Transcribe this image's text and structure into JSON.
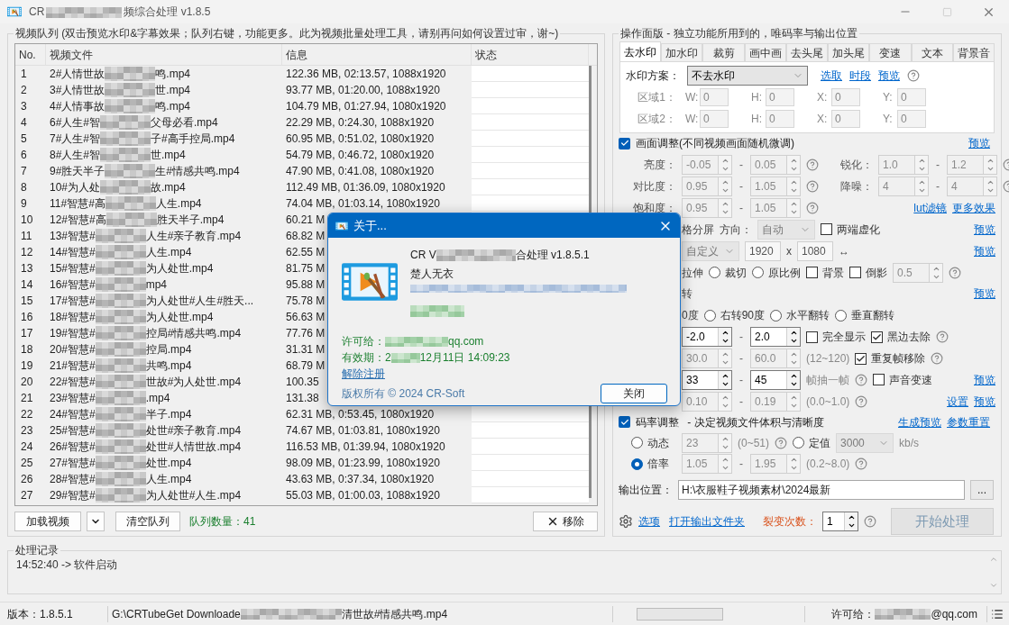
{
  "window": {
    "title_start": "CR",
    "title_end": "频综合处理 v1.8.5"
  },
  "queue": {
    "title": "视频队列 (双击预览水印&字幕效果；队列右键，功能更多。此为视频批量处理工具，请别再问如何设置过审，谢~)",
    "columns": [
      "No.",
      "视频文件",
      "信息",
      "状态"
    ],
    "rows": [
      {
        "no": "1",
        "file_start": "2#人情世故",
        "file_end": "鸣.mp4",
        "info": "122.36 MB, 02:13.57, 1088x1920"
      },
      {
        "no": "2",
        "file_start": "3#人情世故",
        "file_end": "世.mp4",
        "info": "93.77 MB, 01:20.00, 1088x1920"
      },
      {
        "no": "3",
        "file_start": "4#人情事故",
        "file_end": "鸣.mp4",
        "info": "104.79 MB, 01:27.94, 1080x1920"
      },
      {
        "no": "4",
        "file_start": "6#人生#智",
        "file_end": "父母必看.mp4",
        "info": "22.29 MB, 0:24.30, 1088x1920"
      },
      {
        "no": "5",
        "file_start": "7#人生#智",
        "file_end": "子#高手控局.mp4",
        "info": "60.95 MB, 0:51.02, 1080x1920"
      },
      {
        "no": "6",
        "file_start": "8#人生#智",
        "file_end": "世.mp4",
        "info": "54.79 MB, 0:46.72, 1080x1920"
      },
      {
        "no": "7",
        "file_start": "9#胜天半子",
        "file_end": "生#情感共鸣.mp4",
        "info": "47.90 MB, 0:41.08, 1080x1920"
      },
      {
        "no": "8",
        "file_start": "10#为人处",
        "file_end": "故.mp4",
        "info": "112.49 MB, 01:36.09, 1080x1920"
      },
      {
        "no": "9",
        "file_start": "11#智慧#高",
        "file_end": "人生.mp4",
        "info": "74.04 MB, 01:03.14, 1080x1920"
      },
      {
        "no": "10",
        "file_start": "12#智慧#高",
        "file_end": "胜天半子.mp4",
        "info": "60.21 M"
      },
      {
        "no": "11",
        "file_start": "13#智慧#",
        "file_end": "人生#亲子教育.mp4",
        "info": "68.82 M"
      },
      {
        "no": "12",
        "file_start": "14#智慧#",
        "file_end": "人生.mp4",
        "info": "62.55 M"
      },
      {
        "no": "13",
        "file_start": "15#智慧#",
        "file_end": "为人处世.mp4",
        "info": "81.75 M"
      },
      {
        "no": "14",
        "file_start": "16#智慧#",
        "file_end": "mp4",
        "info": "95.88 M"
      },
      {
        "no": "15",
        "file_start": "17#智慧#",
        "file_end": "为人处世#人生#胜天...",
        "info": "75.78 M"
      },
      {
        "no": "16",
        "file_start": "18#智慧#",
        "file_end": "为人处世.mp4",
        "info": "56.63 M"
      },
      {
        "no": "17",
        "file_start": "19#智慧#",
        "file_end": "控局#情感共鸣.mp4",
        "info": "77.76 M"
      },
      {
        "no": "18",
        "file_start": "20#智慧#",
        "file_end": "控局.mp4",
        "info": "31.31 M"
      },
      {
        "no": "19",
        "file_start": "21#智慧#",
        "file_end": "共鸣.mp4",
        "info": "68.79 M"
      },
      {
        "no": "20",
        "file_start": "22#智慧#",
        "file_end": "世故#为人处世.mp4",
        "info": "100.35"
      },
      {
        "no": "21",
        "file_start": "23#智慧#",
        "file_end": ".mp4",
        "info": "131.38"
      },
      {
        "no": "22",
        "file_start": "24#智慧#",
        "file_end": "半子.mp4",
        "info": "62.31 MB, 0:53.45, 1080x1920"
      },
      {
        "no": "23",
        "file_start": "25#智慧#",
        "file_end": "处世#亲子教育.mp4",
        "info": "74.67 MB, 01:03.81, 1080x1920"
      },
      {
        "no": "24",
        "file_start": "26#智慧#",
        "file_end": "处世#人情世故.mp4",
        "info": "116.53 MB, 01:39.94, 1080x1920"
      },
      {
        "no": "25",
        "file_start": "27#智慧#",
        "file_end": "处世.mp4",
        "info": "98.09 MB, 01:23.99, 1080x1920"
      },
      {
        "no": "26",
        "file_start": "28#智慧#",
        "file_end": "人生.mp4",
        "info": "43.63 MB, 0:37.34, 1080x1920"
      },
      {
        "no": "27",
        "file_start": "29#智慧#",
        "file_end": "为人处世#人生.mp4",
        "info": "55.03 MB, 01:00.03, 1088x1920"
      }
    ],
    "load_button": "加载视频",
    "clear_button": "清空队列",
    "count": "队列数量：41",
    "remove_button": "移除"
  },
  "panel": {
    "title": "操作面版 - 独立功能所用到的，唯码率与输出位置",
    "tabs": [
      {
        "label": "去水印",
        "selected": true
      },
      {
        "label": "加水印",
        "selected": false
      },
      {
        "label": "裁剪",
        "selected": false
      },
      {
        "label": "画中画",
        "selected": false
      },
      {
        "label": "去头尾",
        "selected": false
      },
      {
        "label": "加头尾",
        "selected": false
      },
      {
        "label": "变速",
        "selected": false
      },
      {
        "label": "文本",
        "selected": false
      },
      {
        "label": "背景音",
        "selected": false
      }
    ],
    "watermark": {
      "label": "水印方案：",
      "value": "不去水印",
      "links": [
        "选取",
        "时段",
        "预览"
      ],
      "regions": [
        {
          "label": "区域1：",
          "fields": [
            {
              "label": "W:",
              "value": "0"
            },
            {
              "label": "H:",
              "value": "0"
            },
            {
              "label": "X:",
              "value": "0"
            },
            {
              "label": "Y:",
              "value": "0"
            }
          ]
        },
        {
          "label": "区域2：",
          "fields": [
            {
              "label": "W:",
              "value": "0"
            },
            {
              "label": "H:",
              "value": "0"
            },
            {
              "label": "X:",
              "value": "0"
            },
            {
              "label": "Y:",
              "value": "0"
            }
          ]
        }
      ]
    },
    "adjust": {
      "label": "画面调整(不同视频画面随机微调)",
      "checked": true,
      "link": "预览",
      "rows": [
        {
          "items": [
            {
              "kind": "label",
              "text": "亮度："
            },
            {
              "kind": "spin",
              "value": "-0.05",
              "disabled": true
            },
            {
              "kind": "dash",
              "text": "-"
            },
            {
              "kind": "spin",
              "value": "0.05",
              "disabled": true
            },
            {
              "kind": "help"
            },
            {
              "kind": "label",
              "text": "锐化："
            },
            {
              "kind": "spin",
              "value": "1.0",
              "disabled": true
            },
            {
              "kind": "dash",
              "text": "-"
            },
            {
              "kind": "spin",
              "value": "1.2",
              "disabled": true
            },
            {
              "kind": "help"
            }
          ]
        },
        {
          "items": [
            {
              "kind": "label",
              "text": "对比度："
            },
            {
              "kind": "spin",
              "value": "0.95",
              "disabled": true
            },
            {
              "kind": "dash",
              "text": "-"
            },
            {
              "kind": "spin",
              "value": "1.05",
              "disabled": true
            },
            {
              "kind": "help"
            },
            {
              "kind": "label",
              "text": "降噪："
            },
            {
              "kind": "spin",
              "value": "4",
              "disabled": true
            },
            {
              "kind": "dash",
              "text": "-"
            },
            {
              "kind": "spin",
              "value": "4",
              "disabled": true
            },
            {
              "kind": "help"
            }
          ]
        },
        {
          "items": [
            {
              "kind": "label",
              "text": "饱和度："
            },
            {
              "kind": "spin",
              "value": "0.95",
              "disabled": true
            },
            {
              "kind": "dash",
              "text": "-"
            },
            {
              "kind": "spin",
              "value": "1.05",
              "disabled": true
            },
            {
              "kind": "help"
            },
            {
              "kind": "link",
              "text": "lut滤镜"
            },
            {
              "kind": "link",
              "text": "更多效果"
            }
          ]
        },
        {
          "items": [
            {
              "kind": "text",
              "text": "格分屏"
            },
            {
              "kind": "text",
              "text": "方向："
            },
            {
              "kind": "select",
              "value": "自动",
              "disabled": true
            },
            {
              "kind": "check",
              "text": "两端虚化",
              "checked": false
            },
            {
              "kind": "link",
              "text": "预览"
            }
          ]
        },
        {
          "items": [
            {
              "kind": "select",
              "value": "自定义",
              "disabled": true
            },
            {
              "kind": "input",
              "value": "1920"
            },
            {
              "kind": "text",
              "text": "x"
            },
            {
              "kind": "input",
              "value": "1080"
            },
            {
              "kind": "text",
              "text": "↔"
            },
            {
              "kind": "link",
              "text": "预览"
            }
          ]
        },
        {
          "items": [
            {
              "kind": "text",
              "text": "拉伸"
            },
            {
              "kind": "radio",
              "text": "裁切",
              "selected": false
            },
            {
              "kind": "radio",
              "text": "原比例",
              "selected": false
            },
            {
              "kind": "check",
              "text": "背景",
              "checked": false
            },
            {
              "kind": "check",
              "text": "倒影",
              "checked": false
            },
            {
              "kind": "spin",
              "value": "0.5",
              "disabled": true
            },
            {
              "kind": "help"
            }
          ]
        },
        {
          "items": [
            {
              "kind": "text",
              "text": "转"
            },
            {
              "kind": "link",
              "text": "预览"
            }
          ]
        },
        {
          "items": [
            {
              "kind": "text",
              "text": "0度"
            },
            {
              "kind": "radio",
              "text": "右转90度",
              "selected": false
            },
            {
              "kind": "radio",
              "text": "水平翻转",
              "selected": false
            },
            {
              "kind": "radio",
              "text": "垂直翻转",
              "selected": false
            }
          ]
        },
        {
          "items": [
            {
              "kind": "spin",
              "value": "-2.0",
              "disabled": false
            },
            {
              "kind": "dash",
              "text": "-"
            },
            {
              "kind": "spin",
              "value": "2.0",
              "disabled": false
            },
            {
              "kind": "check",
              "text": "完全显示",
              "checked": false
            },
            {
              "kind": "check",
              "text": "黑边去除",
              "checked": true
            },
            {
              "kind": "help"
            }
          ]
        },
        {
          "items": [
            {
              "kind": "spin",
              "value": "30.0",
              "disabled": true
            },
            {
              "kind": "dash",
              "text": "-"
            },
            {
              "kind": "spin",
              "value": "60.0",
              "disabled": true
            },
            {
              "kind": "hint",
              "text": "(12~120)"
            },
            {
              "kind": "check",
              "text": "重复帧移除",
              "checked": true
            },
            {
              "kind": "help"
            }
          ]
        },
        {
          "items": [
            {
              "kind": "spin",
              "value": "33",
              "disabled": false
            },
            {
              "kind": "dash",
              "text": "-"
            },
            {
              "kind": "spin",
              "value": "45",
              "disabled": false
            },
            {
              "kind": "hint",
              "text": "帧抽一帧"
            },
            {
              "kind": "help"
            },
            {
              "kind": "check",
              "text": "声音变速",
              "checked": false
            },
            {
              "kind": "link",
              "text": "预览"
            }
          ]
        },
        {
          "items": [
            {
              "kind": "spin",
              "value": "0.10",
              "disabled": true
            },
            {
              "kind": "dash",
              "text": "-"
            },
            {
              "kind": "spin",
              "value": "0.19",
              "disabled": true
            },
            {
              "kind": "hint",
              "text": "(0.0~1.0)"
            },
            {
              "kind": "help"
            },
            {
              "kind": "link",
              "text": "设置"
            },
            {
              "kind": "link",
              "text": "预览"
            }
          ]
        }
      ]
    },
    "bitrate": {
      "label": "码率调整",
      "note": " - 决定视频文件体积与清晰度",
      "checked": true,
      "links": [
        "生成预览",
        "参数重置"
      ],
      "rows": [
        {
          "items": [
            {
              "kind": "radio",
              "text": "动态",
              "selected": false
            },
            {
              "kind": "spin",
              "value": "23",
              "disabled": true
            },
            {
              "kind": "hint",
              "text": "(0~51)"
            },
            {
              "kind": "help"
            },
            {
              "kind": "radio",
              "text": "定值",
              "selected": false
            },
            {
              "kind": "select",
              "value": "3000",
              "disabled": true
            },
            {
              "kind": "hint",
              "text": "kb/s"
            }
          ]
        },
        {
          "items": [
            {
              "kind": "radio",
              "text": "倍率",
              "selected": true
            },
            {
              "kind": "spin",
              "value": "1.05",
              "disabled": true
            },
            {
              "kind": "dash",
              "text": "-"
            },
            {
              "kind": "spin",
              "value": "1.95",
              "disabled": true
            },
            {
              "kind": "hint",
              "text": "(0.2~8.0)"
            },
            {
              "kind": "help"
            }
          ]
        }
      ]
    },
    "output": {
      "label": "输出位置：",
      "value": "H:\\衣服鞋子视频素材\\2024最新",
      "browse": "..."
    },
    "actions": {
      "options": "选项",
      "open_folder": "打开输出文件夹",
      "count_label": "裂变次数：",
      "count": {
        "value": "1",
        "disabled": false
      },
      "start": {
        "label": "开始处理",
        "disabled": true
      }
    }
  },
  "log": {
    "title": "处理记录",
    "lines": [
      "14:52:40 -> 软件启动"
    ]
  },
  "status_bar": {
    "version": "版本：1.8.5.1",
    "path_start": "G:\\CRTubeGet Downloade",
    "path_end": "清世故#情感共鸣.mp4",
    "progress": {
      "level": 0
    },
    "license_label": "许可给：",
    "license_end": "@qq.com"
  },
  "dialog": {
    "title": "关于...",
    "product_start": "CR V",
    "product_end": "合处理 v1.8.5.1",
    "author": "楚人无衣",
    "license_label": "许可给：",
    "license_end": "qq.com",
    "expiry_label": "有效期：",
    "expiry_start": "2",
    "expiry_end": "12月11日 14:09:23",
    "unregister": "解除注册",
    "copyright": "版权所有 © 2024 CR-Soft",
    "close": "关闭"
  }
}
